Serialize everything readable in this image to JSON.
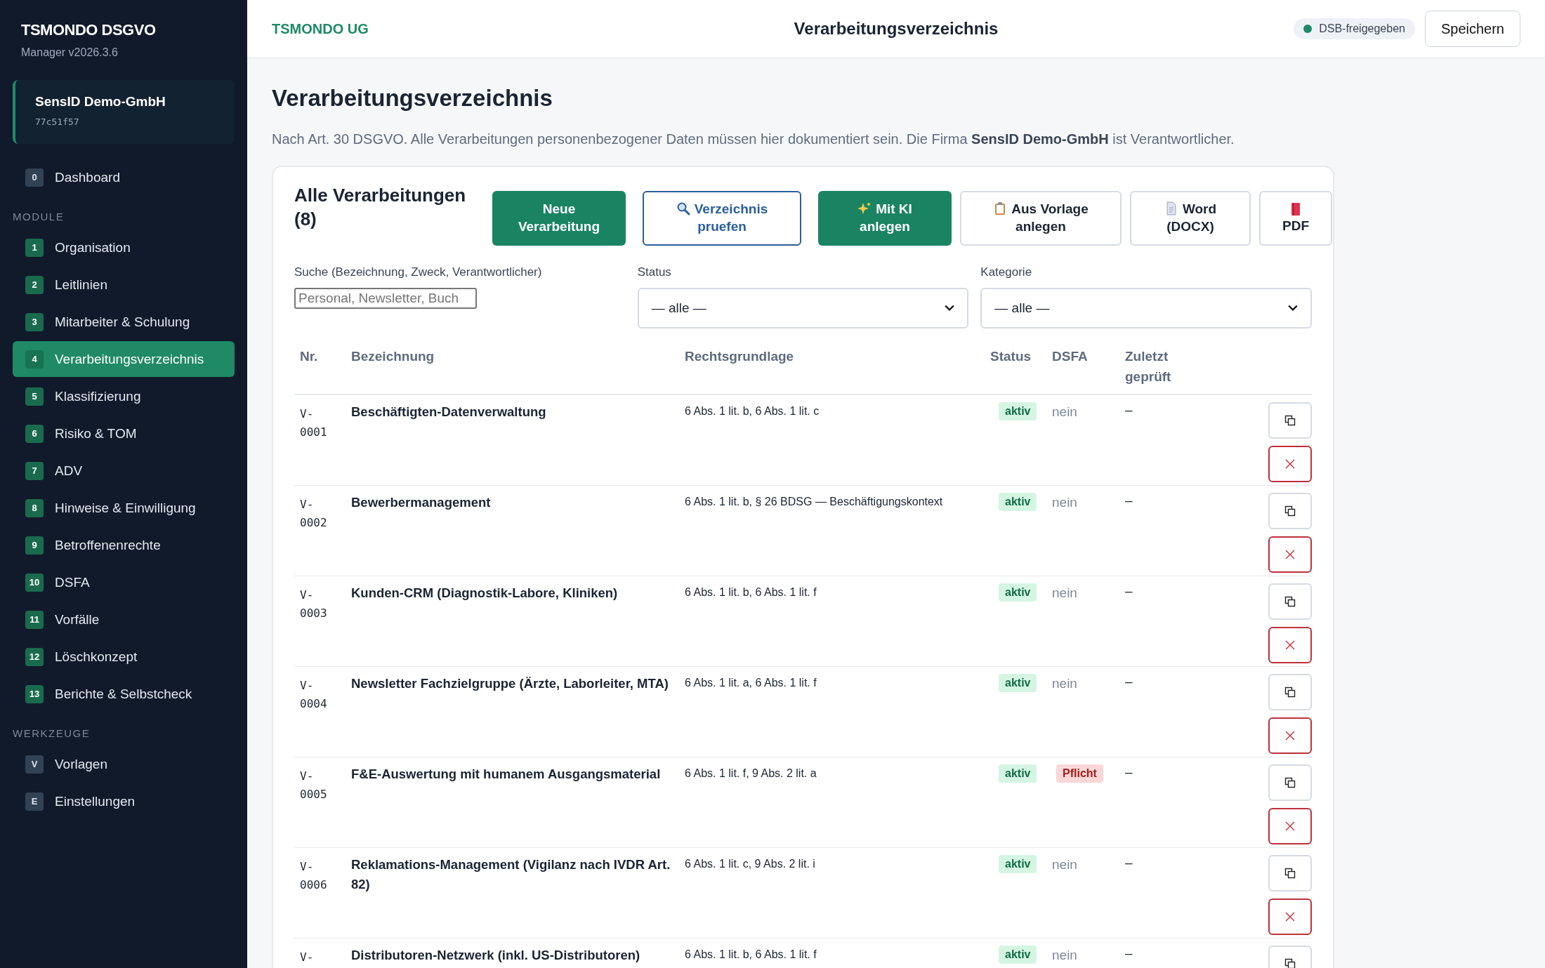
{
  "sidebar": {
    "brand": "TSMONDO DSGVO",
    "version": "Manager v2026.3.6",
    "tenant": {
      "name": "SensID Demo-GmbH",
      "id": "77c51f57"
    },
    "top_items": [
      {
        "badge": "0",
        "label": "Dashboard",
        "kind": "plain",
        "selected": false
      }
    ],
    "sections": [
      {
        "heading": "MODULE",
        "items": [
          {
            "badge": "1",
            "label": "Organisation",
            "kind": "module",
            "selected": false
          },
          {
            "badge": "2",
            "label": "Leitlinien",
            "kind": "module",
            "selected": false
          },
          {
            "badge": "3",
            "label": "Mitarbeiter & Schulung",
            "kind": "module",
            "selected": false
          },
          {
            "badge": "4",
            "label": "Verarbeitungsverzeichnis",
            "kind": "module",
            "selected": true
          },
          {
            "badge": "5",
            "label": "Klassifizierung",
            "kind": "module",
            "selected": false
          },
          {
            "badge": "6",
            "label": "Risiko & TOM",
            "kind": "module",
            "selected": false
          },
          {
            "badge": "7",
            "label": "ADV",
            "kind": "module",
            "selected": false
          },
          {
            "badge": "8",
            "label": "Hinweise & Einwilligung",
            "kind": "module",
            "selected": false
          },
          {
            "badge": "9",
            "label": "Betroffenenrechte",
            "kind": "module",
            "selected": false
          },
          {
            "badge": "10",
            "label": "DSFA",
            "kind": "module",
            "selected": false
          },
          {
            "badge": "11",
            "label": "Vorfälle",
            "kind": "module",
            "selected": false
          },
          {
            "badge": "12",
            "label": "Löschkonzept",
            "kind": "module",
            "selected": false
          },
          {
            "badge": "13",
            "label": "Berichte & Selbstcheck",
            "kind": "module",
            "selected": false
          }
        ]
      },
      {
        "heading": "WERKZEUGE",
        "items": [
          {
            "badge": "V",
            "label": "Vorlagen",
            "kind": "plain",
            "selected": false
          },
          {
            "badge": "E",
            "label": "Einstellungen",
            "kind": "plain",
            "selected": false
          }
        ]
      }
    ]
  },
  "header": {
    "company": "TSMONDO UG",
    "title": "Verarbeitungsverzeichnis",
    "status": "DSB-freigegeben",
    "save": "Speichern"
  },
  "page": {
    "title": "Verarbeitungsverzeichnis",
    "intro": "Nach Art. 30 DSGVO. Alle Verarbeitungen personenbezogener Daten müssen hier dokumentiert sein. Die Firma **SensID Demo-GmbH** ist Verantwortlicher."
  },
  "card": {
    "title": "Alle Verarbeitungen (8)",
    "actions": [
      {
        "label": "Neue Verarbeitung",
        "kind": "primary"
      },
      {
        "label": "Verzeichnis pruefen",
        "kind": "outline"
      },
      {
        "label": "Mit KI anlegen",
        "kind": "primary"
      },
      {
        "label": "Aus Vorlage anlegen",
        "kind": "secondary"
      },
      {
        "label": "Word (DOCX)",
        "kind": "secondary"
      },
      {
        "label": "PDF",
        "kind": "secondary"
      }
    ],
    "filters": {
      "search": {
        "label": "Suche (Bezeichnung, Zweck, Verantwortlicher)",
        "placeholder": "Personal, Newsletter, Buch"
      },
      "status": {
        "label": "Status",
        "value": "— alle —"
      },
      "category": {
        "label": "Kategorie",
        "value": "— alle —"
      }
    },
    "table": {
      "columns": [
        "Nr.",
        "Bezeichnung",
        "Rechtsgrundlage",
        "Status",
        "DSFA",
        "Zuletzt geprüft"
      ],
      "rows": [
        {
          "nr": "V-0001",
          "name": "Beschäftigten-Datenverwaltung",
          "basis": "6 Abs. 1 lit. b, 6 Abs. 1 lit. c",
          "status": "aktiv",
          "dsfa": "nein",
          "dsfa_required": false,
          "checked": "–"
        },
        {
          "nr": "V-0002",
          "name": "Bewerbermanagement",
          "basis": "6 Abs. 1 lit. b, § 26 BDSG — Beschäftigungskontext",
          "status": "aktiv",
          "dsfa": "nein",
          "dsfa_required": false,
          "checked": "–"
        },
        {
          "nr": "V-0003",
          "name": "Kunden-CRM (Diagnostik-Labore, Kliniken)",
          "basis": "6 Abs. 1 lit. b, 6 Abs. 1 lit. f",
          "status": "aktiv",
          "dsfa": "nein",
          "dsfa_required": false,
          "checked": "–"
        },
        {
          "nr": "V-0004",
          "name": "Newsletter Fachzielgruppe (Ärzte, Laborleiter, MTA)",
          "basis": "6 Abs. 1 lit. a, 6 Abs. 1 lit. f",
          "status": "aktiv",
          "dsfa": "nein",
          "dsfa_required": false,
          "checked": "–"
        },
        {
          "nr": "V-0005",
          "name": "F&E-Auswertung mit humanem Ausgangsmaterial",
          "basis": "6 Abs. 1 lit. f, 9 Abs. 2 lit. a",
          "status": "aktiv",
          "dsfa": "Pflicht",
          "dsfa_required": true,
          "checked": "–"
        },
        {
          "nr": "V-0006",
          "name": "Reklamations-Management (Vigilanz nach IVDR Art. 82)",
          "basis": "6 Abs. 1 lit. c, 9 Abs. 2 lit. i",
          "status": "aktiv",
          "dsfa": "nein",
          "dsfa_required": false,
          "checked": "–"
        },
        {
          "nr": "V-",
          "name": "Distributoren-Netzwerk (inkl. US-Distributoren)",
          "basis": "6 Abs. 1 lit. b, 6 Abs. 1 lit. f",
          "status": "aktiv",
          "dsfa": "nein",
          "dsfa_required": false,
          "checked": "–"
        }
      ]
    }
  }
}
